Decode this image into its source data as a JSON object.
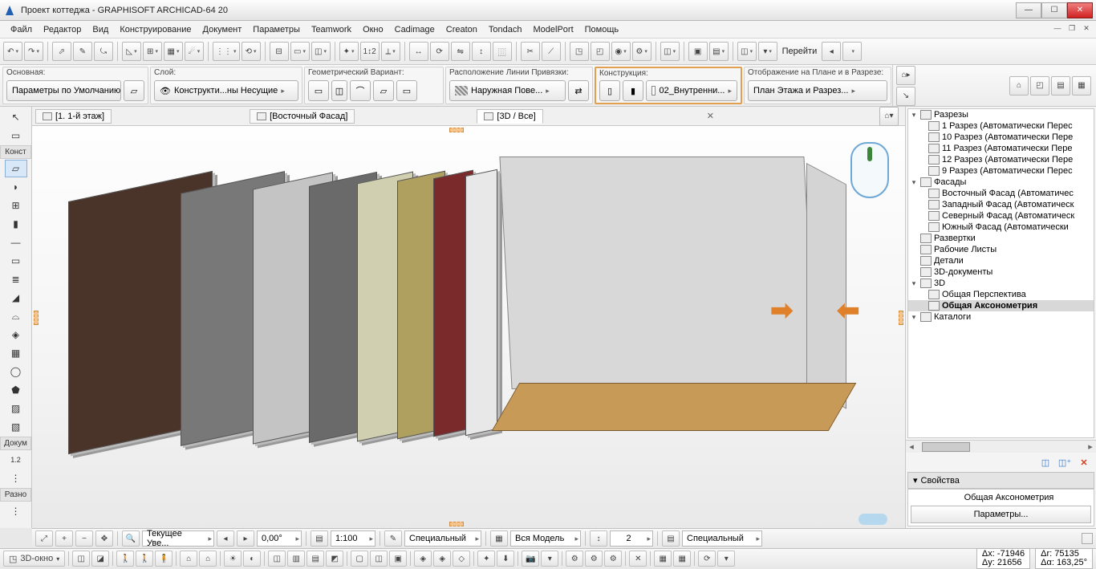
{
  "window": {
    "title": "Проект коттеджа - GRAPHISOFT ARCHICAD-64 20"
  },
  "menu": [
    "Файл",
    "Редактор",
    "Вид",
    "Конструирование",
    "Документ",
    "Параметры",
    "Teamwork",
    "Окно",
    "Cadimage",
    "Creaton",
    "Tondach",
    "ModelPort",
    "Помощь"
  ],
  "nav_label": "Перейти",
  "tb2": {
    "g1_label": "Основная:",
    "g1_value": "Параметры по Умолчанию",
    "g2_label": "Слой:",
    "g2_value": "Конструкти...ны Несущие",
    "g3_label": "Геометрический Вариант:",
    "g4_label": "Расположение Линии Привязки:",
    "g4_value": "Наружная Пове...",
    "g5_label": "Конструкция:",
    "g5_value": "02_Внутренни...",
    "g6_label": "Отображение на Плане и в Разрезе:",
    "g6_value": "План Этажа и Разрез..."
  },
  "left": {
    "cat1": "Конст",
    "cat2": "Докум",
    "cat3": "Разно"
  },
  "tabs": [
    {
      "label": "[1. 1-й этаж]",
      "active": false
    },
    {
      "label": "[Восточный Фасад]",
      "active": false
    },
    {
      "label": "[3D / Все]",
      "active": true
    }
  ],
  "tree": [
    {
      "lvl": 0,
      "tw": "▾",
      "ico": "folder",
      "label": "Разрезы"
    },
    {
      "lvl": 1,
      "tw": "",
      "ico": "sect",
      "label": "1 Разрез (Автоматически Перес"
    },
    {
      "lvl": 1,
      "tw": "",
      "ico": "sect",
      "label": "10 Разрез (Автоматически Пере"
    },
    {
      "lvl": 1,
      "tw": "",
      "ico": "sect",
      "label": "11 Разрез (Автоматически Пере"
    },
    {
      "lvl": 1,
      "tw": "",
      "ico": "sect",
      "label": "12 Разрез (Автоматически Пере"
    },
    {
      "lvl": 1,
      "tw": "",
      "ico": "sect",
      "label": "9 Разрез (Автоматически Перес"
    },
    {
      "lvl": 0,
      "tw": "▾",
      "ico": "folder",
      "label": "Фасады"
    },
    {
      "lvl": 1,
      "tw": "",
      "ico": "elev",
      "label": "Восточный Фасад (Автоматичес"
    },
    {
      "lvl": 1,
      "tw": "",
      "ico": "elev",
      "label": "Западный Фасад (Автоматическ"
    },
    {
      "lvl": 1,
      "tw": "",
      "ico": "elev",
      "label": "Северный Фасад (Автоматическ"
    },
    {
      "lvl": 1,
      "tw": "",
      "ico": "elev",
      "label": "Южный Фасад (Автоматически"
    },
    {
      "lvl": 0,
      "tw": "",
      "ico": "int",
      "label": "Развертки"
    },
    {
      "lvl": 0,
      "tw": "",
      "ico": "ws",
      "label": "Рабочие Листы"
    },
    {
      "lvl": 0,
      "tw": "",
      "ico": "det",
      "label": "Детали"
    },
    {
      "lvl": 0,
      "tw": "",
      "ico": "3dd",
      "label": "3D-документы"
    },
    {
      "lvl": 0,
      "tw": "▾",
      "ico": "3d",
      "label": "3D"
    },
    {
      "lvl": 1,
      "tw": "",
      "ico": "persp",
      "label": "Общая Перспектива"
    },
    {
      "lvl": 1,
      "tw": "",
      "ico": "axo",
      "label": "Общая Аксонометрия",
      "sel": true
    },
    {
      "lvl": 0,
      "tw": "▾",
      "ico": "cat",
      "label": "Каталоги"
    }
  ],
  "props": {
    "header": "Свойства",
    "view_name": "Общая Аксонометрия",
    "params_btn": "Параметры..."
  },
  "status1": {
    "zoom_label": "Текущее Уве...",
    "angle": "0,00°",
    "scale": "1:100",
    "pen_set": "Специальный",
    "model": "Вся Модель",
    "layers_count": "2",
    "reno": "Специальный"
  },
  "status2": {
    "view_name": "3D-окно",
    "dx": "Δx: -71946",
    "dy": "Δy: 21656",
    "dr": "Δr: 75135",
    "da": "Δα: 163,25°"
  }
}
